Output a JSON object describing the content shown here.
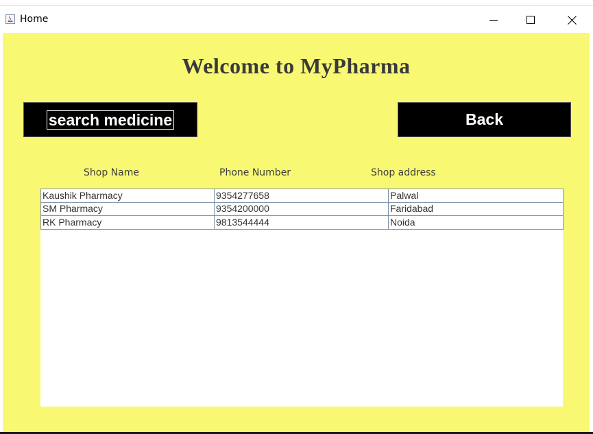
{
  "window": {
    "title": "Home",
    "icon": "java-app-icon"
  },
  "header": {
    "title": "Welcome to MyPharma"
  },
  "buttons": {
    "search_label": "search medicine",
    "back_label": "Back"
  },
  "table": {
    "columns": [
      "Shop Name",
      "Phone Number",
      "Shop address"
    ],
    "rows": [
      [
        "Kaushik Pharmacy",
        "9354277658",
        "Palwal"
      ],
      [
        "SM Pharmacy",
        "9354200000",
        "Faridabad"
      ],
      [
        "RK Pharmacy",
        "9813544444",
        "Noida"
      ]
    ]
  },
  "colors": {
    "background": "#f8f872",
    "button": "#000000",
    "button_text": "#ffffff",
    "heading": "#3a3a3a"
  }
}
